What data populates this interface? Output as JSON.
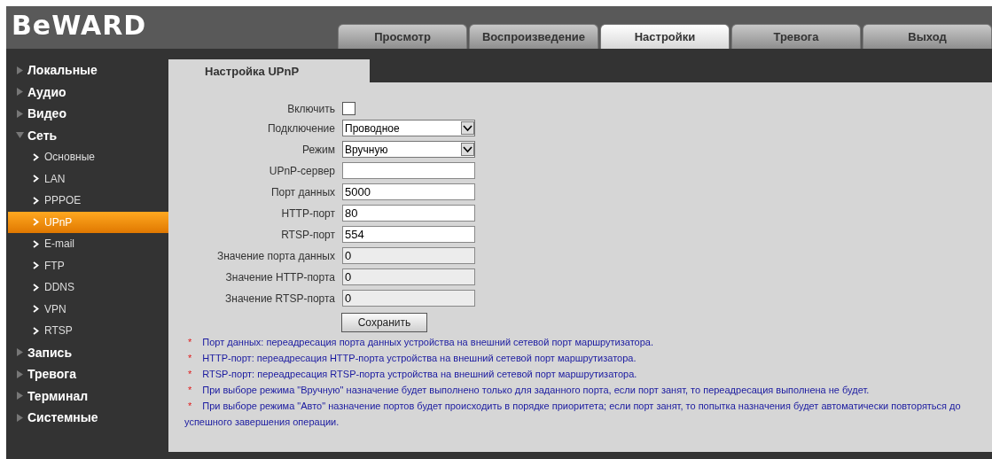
{
  "logo": "BeWARD",
  "tabs": [
    {
      "label": "Просмотр",
      "selected": false
    },
    {
      "label": "Воспроизведение",
      "selected": false
    },
    {
      "label": "Настройки",
      "selected": true
    },
    {
      "label": "Тревога",
      "selected": false
    },
    {
      "label": "Выход",
      "selected": false
    }
  ],
  "sidebar": {
    "items": [
      {
        "label": "Локальные",
        "expanded": false
      },
      {
        "label": "Аудио",
        "expanded": false
      },
      {
        "label": "Видео",
        "expanded": false
      },
      {
        "label": "Сеть",
        "expanded": true,
        "children": [
          {
            "label": "Основные",
            "selected": false
          },
          {
            "label": "LAN",
            "selected": false
          },
          {
            "label": "PPPOE",
            "selected": false
          },
          {
            "label": "UPnP",
            "selected": true
          },
          {
            "label": "E-mail",
            "selected": false
          },
          {
            "label": "FTP",
            "selected": false
          },
          {
            "label": "DDNS",
            "selected": false
          },
          {
            "label": "VPN",
            "selected": false
          },
          {
            "label": "RTSP",
            "selected": false
          }
        ]
      },
      {
        "label": "Запись",
        "expanded": false
      },
      {
        "label": "Тревога",
        "expanded": false
      },
      {
        "label": "Терминал",
        "expanded": false
      },
      {
        "label": "Системные",
        "expanded": false
      }
    ]
  },
  "panel": {
    "title": "Настройка UPnP",
    "fields": [
      {
        "kind": "checkbox",
        "label": "Включить",
        "checked": false
      },
      {
        "kind": "select",
        "label": "Подключение",
        "value": "Проводное"
      },
      {
        "kind": "select",
        "label": "Режим",
        "value": "Вручную"
      },
      {
        "kind": "text",
        "label": "UPnP-сервер",
        "disabled": false
      },
      {
        "kind": "text",
        "label": "Порт данных",
        "value": "5000",
        "disabled": false
      },
      {
        "kind": "text",
        "label": "HTTP-порт",
        "value": "80",
        "disabled": false
      },
      {
        "kind": "text",
        "label": "RTSP-порт",
        "value": "554",
        "disabled": false
      },
      {
        "kind": "text",
        "label": "Значение порта данных",
        "value": "0",
        "disabled": true
      },
      {
        "kind": "text",
        "label": "Значение HTTP-порта",
        "value": "0",
        "disabled": true
      },
      {
        "kind": "text",
        "label": "Значение RTSP-порта",
        "value": "0",
        "disabled": true
      }
    ],
    "save_button": "Сохранить",
    "notes": [
      {
        "mark": "*",
        "text": "Порт данных: переадресация порта данных устройства на внешний сетевой порт маршрутизатора."
      },
      {
        "mark": "*",
        "text": "HTTP-порт: переадресация HTTP-порта устройства на внешний сетевой порт маршрутизатора."
      },
      {
        "mark": "*",
        "text": "RTSP-порт: переадресация RTSP-порта устройства на внешний сетевой порт маршрутизатора."
      },
      {
        "mark": "*",
        "text": "При выборе режима \"Вручную\" назначение будет выполнено только для заданного порта, если порт занят, то переадресация выполнена не будет."
      },
      {
        "mark": "*",
        "text": "При выборе режима \"Авто\" назначение портов будет происходить в порядке приоритета; если порт занят, то попытка назначения будет автоматически повторяться до успешного завершения операции."
      }
    ]
  }
}
